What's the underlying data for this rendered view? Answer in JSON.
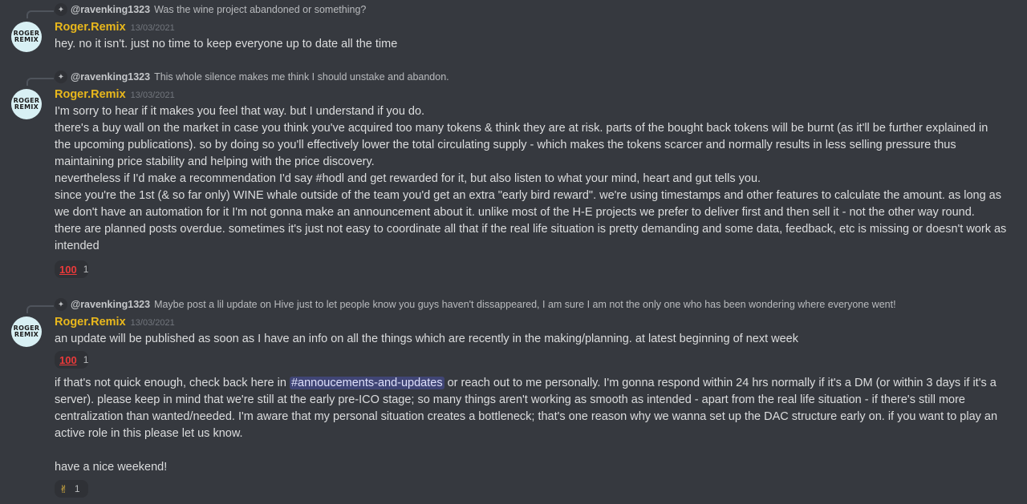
{
  "messages": [
    {
      "reply": {
        "user": "@ravenking1323",
        "text": "Was the wine project abandoned or something?"
      },
      "author": "Roger.Remix",
      "avatar_lines": [
        "ROGER",
        "REMIX"
      ],
      "timestamp": "13/03/2021",
      "lines": [
        "hey. no it isn't. just no time to keep everyone up to date all the time"
      ]
    },
    {
      "reply": {
        "user": "@ravenking1323",
        "text": "This whole silence makes me think I should unstake and abandon."
      },
      "author": "Roger.Remix",
      "avatar_lines": [
        "ROGER",
        "REMIX"
      ],
      "timestamp": "13/03/2021",
      "lines": [
        "I'm sorry to hear if it makes you feel that way. but I understand if you do.",
        "there's a buy wall on the market in case you think you've acquired too many tokens & think they are at risk. parts of the bought back tokens will be burnt (as it'll be further explained in",
        "the upcoming publications). so by doing so you'll effectively lower the total circulating supply - which makes the tokens scarcer and normally results in less selling pressure thus",
        "maintaining price stability and helping with the price discovery.",
        "nevertheless if I'd make a recommendation I'd say #hodl and get rewarded for it, but also listen to what your mind, heart and gut tells you.",
        "since you're the 1st (& so far only) WINE whale outside of the team you'd get an extra \"early bird reward\". we're using timestamps and other features to calculate the amount. as long as",
        "we don't have an automation for it I'm not gonna make an announcement about it. unlike most of the H-E projects we prefer to deliver first and then sell it - not the other way round.",
        "there are planned posts overdue. sometimes it's just not easy to coordinate all that if the real life situation is pretty demanding and some data, feedback, etc is missing or doesn't work as",
        "intended"
      ],
      "reaction": {
        "emoji": "100-icon",
        "symbol": "100",
        "count": "1"
      }
    },
    {
      "reply": {
        "user": "@ravenking1323",
        "text": "Maybe post a lil update on Hive just to let people know you guys haven't dissappeared, I am sure I am not the only one who has been wondering where everyone went!"
      },
      "author": "Roger.Remix",
      "avatar_lines": [
        "ROGER",
        "REMIX"
      ],
      "timestamp": "13/03/2021",
      "lines": [
        "an update will be published as soon as I have an info on all the things which are recently in the making/planning. at latest beginning of next week"
      ],
      "reaction": {
        "emoji": "100-icon",
        "symbol": "100",
        "count": "1"
      },
      "followup": {
        "before_mention": "if that's not quick enough, check back here in ",
        "mention": "#annoucements-and-updates",
        "after_mention": " or reach out to me personally. I'm gonna respond within 24 hrs normally if it's a DM (or within 3 days if it's a",
        "lines": [
          "server). please keep in mind that we're still at the early pre-ICO stage; so many things aren't working as smooth as intended - apart from the real life situation - if there's still more",
          "centralization than wanted/needed. I'm aware that my personal situation creates a bottleneck; that's one reason why we wanna set up the DAC structure early on. if you want to play an",
          "active role in this please let us know.",
          "",
          "have a nice weekend!"
        ],
        "reaction": {
          "emoji": "victory-hand-icon",
          "symbol": "✌",
          "count": "1"
        }
      }
    }
  ],
  "colors": {
    "background": "#36393f",
    "author": "#e9b81c",
    "text": "#dcddde",
    "muted": "#72767d",
    "mention_bg": "#4752c4"
  }
}
